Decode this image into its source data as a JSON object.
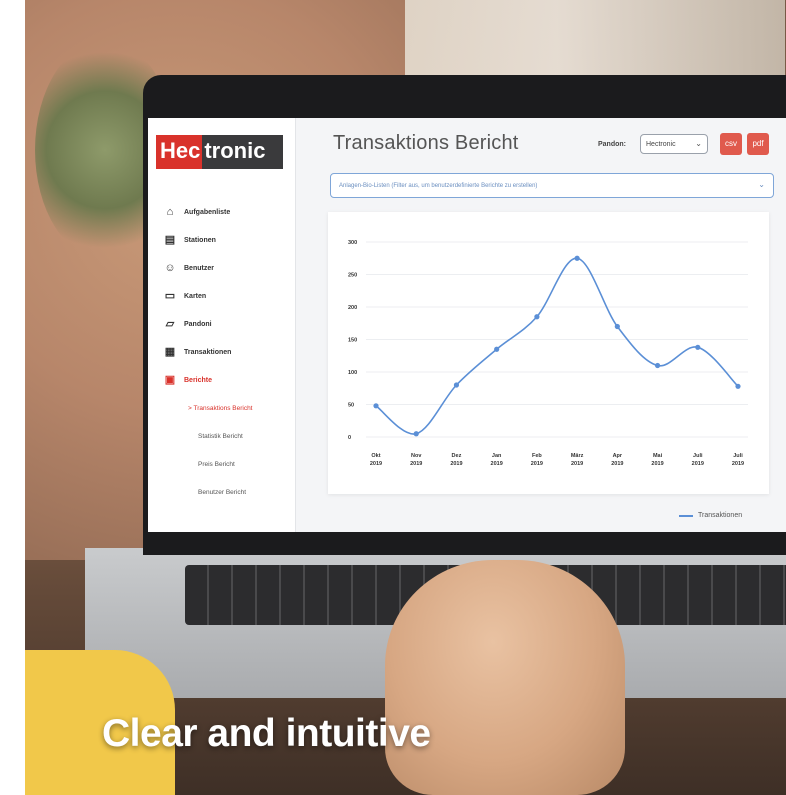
{
  "app": {
    "logo_part1": "Hec",
    "logo_part2": "tronic",
    "page_title": "Transaktions Bericht"
  },
  "sidebar": {
    "items": [
      {
        "label": "Aufgabenliste",
        "icon": "home-icon"
      },
      {
        "label": "Stationen",
        "icon": "station-icon"
      },
      {
        "label": "Benutzer",
        "icon": "users-icon"
      },
      {
        "label": "Karten",
        "icon": "card-icon"
      },
      {
        "label": "Pandoni",
        "icon": "folder-icon"
      },
      {
        "label": "Transaktionen",
        "icon": "transaction-icon"
      },
      {
        "label": "Berichte",
        "icon": "report-icon"
      }
    ],
    "subitems": [
      {
        "label": "> Transaktions Bericht"
      },
      {
        "label": "Statistik Bericht"
      },
      {
        "label": "Preis Bericht"
      },
      {
        "label": "Benutzer Bericht"
      }
    ]
  },
  "header": {
    "pandon_label": "Pandon:",
    "pandon_value": "Hectronic",
    "button1_label": "csv",
    "button2_label": "pdf"
  },
  "search": {
    "placeholder": "Anlagen-Bio-Listen (Filter aus, um benutzerdefinierte Berichte zu erstellen)"
  },
  "legend": {
    "label": "Transaktionen"
  },
  "colors": {
    "accent": "#d9322b",
    "line": "#5b8fd6",
    "button": "#e05a4d"
  },
  "chart_data": {
    "type": "line",
    "categories": [
      "Okt 2019",
      "Nov 2019",
      "Dez 2019",
      "Jan 2019",
      "Feb 2019",
      "März 2019",
      "Apr 2019",
      "Mai 2019",
      "Juli 2019",
      "Juli 2019"
    ],
    "tick_labels_top": [
      "Okt",
      "Nov",
      "Dez",
      "Jan",
      "Feb",
      "März",
      "Apr",
      "Mai",
      "Juli",
      "Juli"
    ],
    "tick_labels_bottom": [
      "2019",
      "2019",
      "2019",
      "2019",
      "2019",
      "2019",
      "2019",
      "2019",
      "2019",
      "2019"
    ],
    "series": [
      {
        "name": "Transaktionen",
        "values": [
          48,
          5,
          80,
          135,
          185,
          275,
          170,
          110,
          138,
          78
        ]
      }
    ],
    "yticks": [
      0,
      50,
      100,
      150,
      200,
      250,
      300
    ],
    "ytick_labels": [
      "0",
      "50",
      "100",
      "150",
      "200",
      "250",
      "300"
    ],
    "ylim": [
      0,
      300
    ],
    "grid": true,
    "legend_position": "bottom-right"
  },
  "caption": "Clear and intuitive"
}
